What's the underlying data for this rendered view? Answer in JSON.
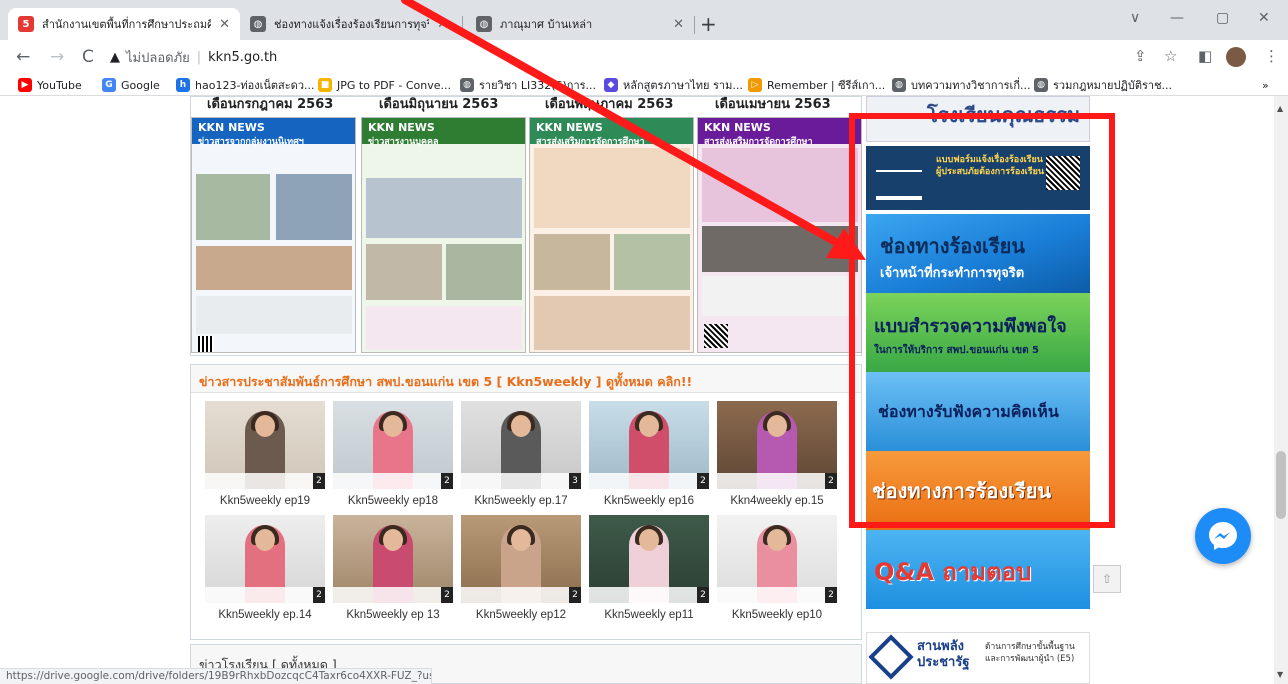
{
  "browser": {
    "tabs": [
      {
        "title": "สำนักงานเขตพื้นที่การศึกษาประถมศึกษ",
        "favicon": "5",
        "active": true
      },
      {
        "title": "ช่องทางแจ้งเรื่องร้องเรียนการทุจริตแล",
        "favicon": "globe",
        "active": false
      },
      {
        "title": "ภาณุมาศ บ้านเหล่า",
        "favicon": "globe",
        "active": false
      }
    ],
    "new_tab": "+",
    "window_controls": [
      "∨",
      "—",
      "▢",
      "✕"
    ],
    "security_label": "ไม่ปลอดภัย",
    "url": "kkn5.go.th",
    "bookmarks": [
      {
        "label": "YouTube",
        "icon_color": "#ff0000"
      },
      {
        "label": "Google",
        "icon_color": "#4285f4"
      },
      {
        "label": "hao123-ท่องเน็ตสะดว...",
        "icon_color": "#1a73e8"
      },
      {
        "label": "JPG to PDF - Conve...",
        "icon_color": "#f4b400"
      },
      {
        "label": "รายวิชา LI332(S)การ...",
        "icon_color": "#5f6368"
      },
      {
        "label": "หลักสูตรภาษาไทย ราม...",
        "icon_color": "#5b4ae0"
      },
      {
        "label": "Remember | ซีรีส์เกา...",
        "icon_color": "#f29900"
      },
      {
        "label": "บทความทางวิชาการเกี่...",
        "icon_color": "#5f6368"
      },
      {
        "label": "รวมกฎหมายปฏิบัติราช...",
        "icon_color": "#5f6368"
      }
    ],
    "bookmarks_more": "»",
    "status_url": "https://drive.google.com/drive/folders/19B9rRhxbDozcqcC4Taxr6co4XXR-FUZ_?us..."
  },
  "page": {
    "month_headers": [
      "เดือนกรกฎาคม 2563",
      "เดือนมิถุนายน 2563",
      "เดือนพฤษภาคม 2563",
      "เดือนเมษายน 2563"
    ],
    "posters": [
      {
        "brand": "KKN NEWS",
        "headline": "ข่าวสารจากกลุ่มงานนิเทศฯ",
        "color": "#1565c0"
      },
      {
        "brand": "KKN NEWS",
        "headline": "ข่าวสารงานบุคคล",
        "color": "#2e7d32"
      },
      {
        "brand": "KKN NEWS",
        "headline": "สารส่งเสริมการจัดการศึกษา",
        "color": "#c2185b"
      },
      {
        "brand": "KKN NEWS",
        "headline": "สารส่งเสริมการจัดการศึกษา",
        "color": "#6a1b9a"
      }
    ],
    "news_header": "ข่าวสารประชาสัมพันธ์การศึกษา สพป.ขอนแก่น เขต 5 [ Kkn5weekly ] ดูทั้งหมด คลิก!!",
    "videos": [
      {
        "label": "Kkn5weekly ep19",
        "num": "2"
      },
      {
        "label": "Kkn5weekly ep18",
        "num": "2"
      },
      {
        "label": "Kkn5weekly ep.17",
        "num": "3"
      },
      {
        "label": "Kkn5weekly ep16",
        "num": "2"
      },
      {
        "label": "Kkn4weekly ep.15",
        "num": "2"
      },
      {
        "label": "Kkn5weekly ep.14",
        "num": "2"
      },
      {
        "label": "Kkn5weekly ep 13",
        "num": "2"
      },
      {
        "label": "Kkn5weekly ep12",
        "num": "2"
      },
      {
        "label": "Kkn5weekly ep11",
        "num": "2"
      },
      {
        "label": "Kkn5weekly ep10",
        "num": "2"
      }
    ],
    "school_news_header": "ข่าวโรงเรียน [ ดูทั้งหมด ]"
  },
  "sidebar": {
    "top_banner_text": "โรงเรียนคุณธรรม",
    "second_banner_text": "แบบฟอร์มแจ้งเรื่องร้องเรียน ผู้ประสบภัยต้องการร้องเรียน",
    "banners": [
      {
        "title": "ช่องทางร้องเรียน",
        "subtitle": "เจ้าหน้าที่กระทำการทุจริต",
        "bg": "#1a7fd8"
      },
      {
        "title": "แบบสำรวจความพึงพอใจ",
        "subtitle": "ในการให้บริการ สพป.ขอนแก่น เขต 5",
        "bg": "#5cb85c"
      },
      {
        "title": "ช่องทางรับฟังความคิดเห็น",
        "subtitle": "",
        "bg": "#2a8fd8"
      },
      {
        "title": "ช่องทางการร้องเรียน",
        "subtitle": "",
        "bg": "#f07b1e"
      },
      {
        "title": "Q&A ถามตอบ",
        "subtitle": "",
        "bg": "#1e90e0"
      }
    ],
    "logo_main": "สานพลัง ประชารัฐ",
    "logo_sub": "ด้านการศึกษาขั้นพื้นฐาน และการพัฒนาผู้นำ (E5)"
  },
  "colors": {
    "highlight": "#ff1a1a",
    "accent_orange": "#e86e1a"
  }
}
